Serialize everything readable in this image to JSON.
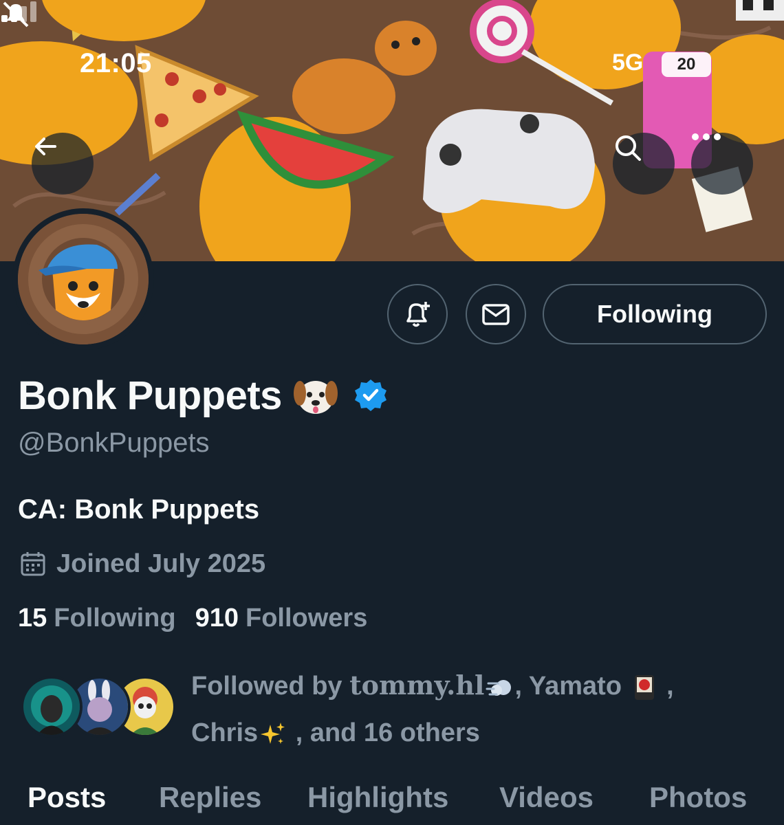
{
  "status_bar": {
    "time": "21:05",
    "network": "5G",
    "battery": "20"
  },
  "profile": {
    "display_name": "Bonk Puppets",
    "handle": "@BonkPuppets",
    "bio": "CA: Bonk Puppets",
    "joined": "Joined July 2025",
    "following_count": "15",
    "following_label": "Following",
    "followers_count": "910",
    "followers_label": "Followers"
  },
  "actions": {
    "following_button": "Following"
  },
  "followed_by": {
    "prefix": "Followed by ",
    "name1": "tommy.hl",
    "sep1": ", Yamato",
    "sep2": " ,",
    "name3": "Chris",
    "suffix": " , and 16 others"
  },
  "tabs": [
    {
      "label": "Posts"
    },
    {
      "label": "Replies"
    },
    {
      "label": "Highlights"
    },
    {
      "label": "Videos"
    },
    {
      "label": "Photos"
    }
  ],
  "icons": {
    "back": "arrow-left-icon",
    "search": "search-icon",
    "more": "more-icon",
    "notify": "bell-plus-icon",
    "message": "envelope-icon",
    "calendar": "calendar-icon",
    "verified": "verified-badge-icon"
  },
  "colors": {
    "background": "#15202b",
    "verified": "#1d9bf0",
    "secondary_text": "#8b98a5"
  }
}
